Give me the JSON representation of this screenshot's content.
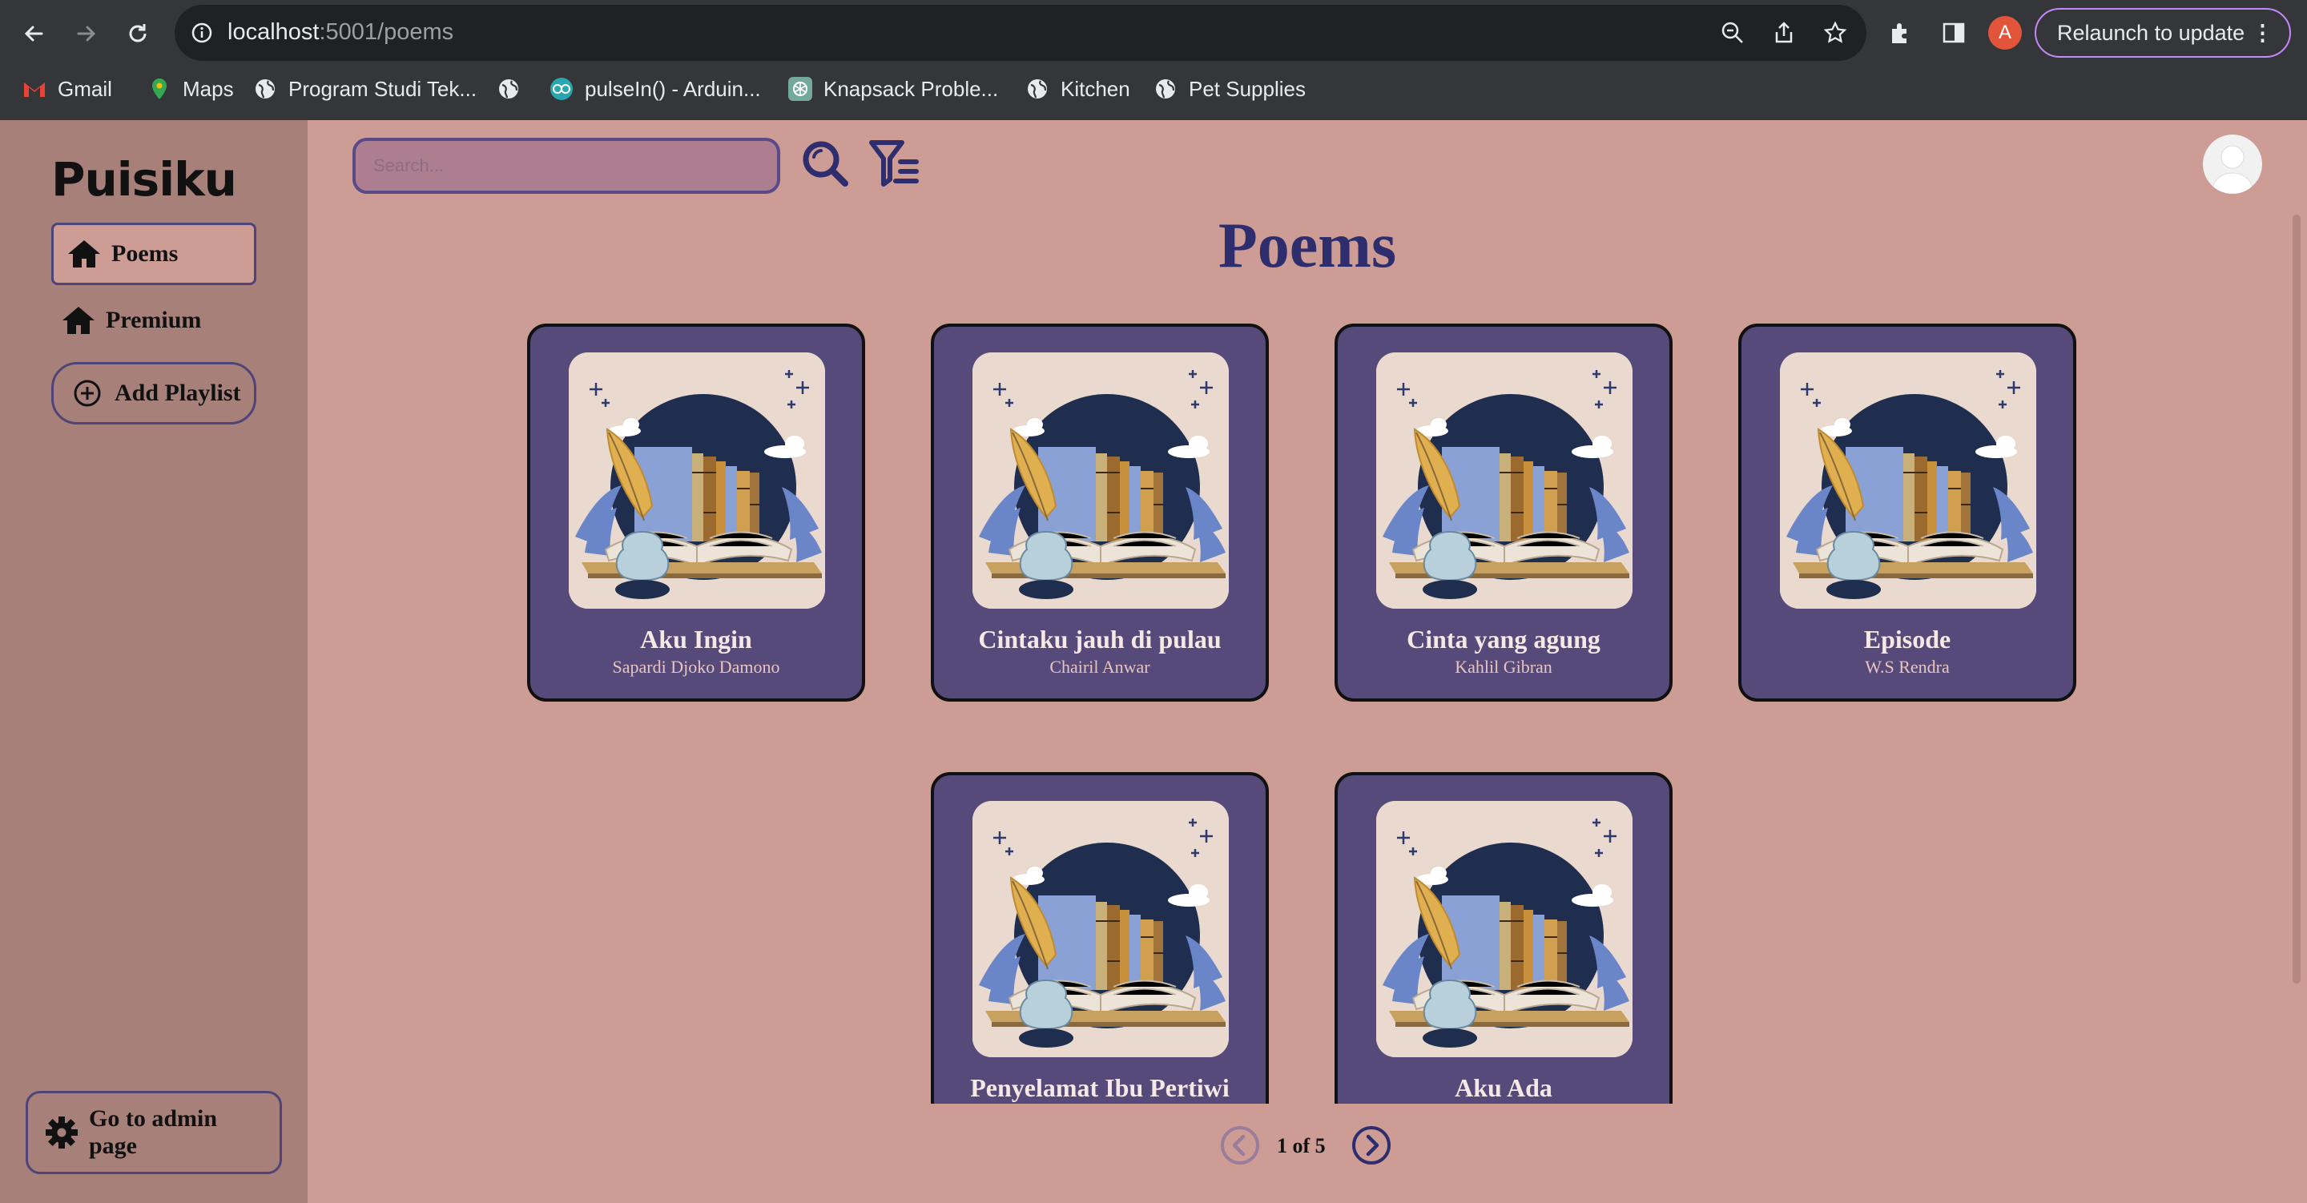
{
  "browser": {
    "url_host": "localhost",
    "url_path": ":5001/poems",
    "relaunch_label": "Relaunch to update",
    "profile_initial": "A",
    "bookmarks": [
      {
        "label": "Gmail",
        "icon": "gmail-icon"
      },
      {
        "label": "Maps",
        "icon": "maps-icon"
      },
      {
        "label": "Program Studi Tek...",
        "icon": "globe-icon"
      },
      {
        "label": "",
        "icon": "globe-icon"
      },
      {
        "label": "pulseIn() - Arduin...",
        "icon": "arduino-icon"
      },
      {
        "label": "Knapsack Proble...",
        "icon": "openai-icon"
      },
      {
        "label": "Kitchen",
        "icon": "globe-icon"
      },
      {
        "label": "Pet Supplies",
        "icon": "globe-icon"
      }
    ]
  },
  "sidebar": {
    "brand": "Puisiku",
    "nav": [
      {
        "label": "Poems",
        "icon": "home-icon",
        "active": true
      },
      {
        "label": "Premium",
        "icon": "home-icon",
        "active": false
      }
    ],
    "add_playlist_label": "Add Playlist",
    "admin_label": "Go to admin page"
  },
  "header": {
    "search_placeholder": "Search..."
  },
  "main": {
    "title": "Poems",
    "poems": [
      {
        "title": "Aku Ingin",
        "author": "Sapardi Djoko Damono"
      },
      {
        "title": "Cintaku jauh di pulau",
        "author": "Chairil Anwar"
      },
      {
        "title": "Cinta yang agung",
        "author": "Kahlil Gibran"
      },
      {
        "title": "Episode",
        "author": "W.S Rendra"
      },
      {
        "title": "Penyelamat Ibu Pertiwi",
        "author": ""
      },
      {
        "title": "Aku Ada",
        "author": ""
      }
    ],
    "pagination": {
      "label": "1 of 5"
    }
  },
  "colors": {
    "page_bg": "#cc9c95",
    "sidebar_bg": "#a78079",
    "card_bg": "#564a7a",
    "accent": "#2e2d6e"
  }
}
